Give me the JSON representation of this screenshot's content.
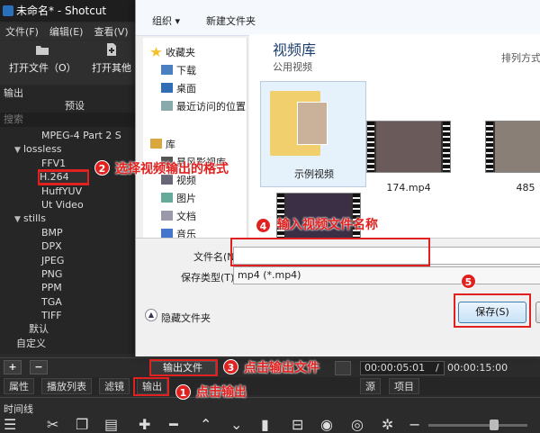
{
  "window": {
    "title": "未命名* - Shotcut"
  },
  "menu": [
    "文件(F)",
    "编辑(E)",
    "查看(V)"
  ],
  "toolbar": {
    "open_file": "打开文件（O）",
    "open_other": "打开其他"
  },
  "export_panel": {
    "header": "输出",
    "column": "预设",
    "search_placeholder": "搜索",
    "items": [
      {
        "label": "MPEG-4 Part 2 S",
        "indent": 3
      },
      {
        "label": "lossless",
        "indent": 1,
        "expanded": true
      },
      {
        "label": "FFV1",
        "indent": 3
      },
      {
        "label": "H.264",
        "indent": 3,
        "selected": true
      },
      {
        "label": "HuffYUV",
        "indent": 3
      },
      {
        "label": "Ut Video",
        "indent": 3
      },
      {
        "label": "stills",
        "indent": 1,
        "expanded": true
      },
      {
        "label": "BMP",
        "indent": 3
      },
      {
        "label": "DPX",
        "indent": 3
      },
      {
        "label": "JPEG",
        "indent": 3
      },
      {
        "label": "PNG",
        "indent": 3
      },
      {
        "label": "PPM",
        "indent": 3
      },
      {
        "label": "TGA",
        "indent": 3
      },
      {
        "label": "TIFF",
        "indent": 3
      },
      {
        "label": "默认",
        "indent": 2
      },
      {
        "label": "自定义",
        "indent": 1
      }
    ]
  },
  "bottom": {
    "add": "+",
    "remove": "−",
    "export_file": "输出文件",
    "current_time": "00:00:05:01",
    "slash": "/",
    "total_time": "00:00:15:00",
    "tabs": [
      "属性",
      "播放列表",
      "滤镜",
      "输出"
    ],
    "right_tabs": [
      "源",
      "项目"
    ],
    "timeline_label": "时间线"
  },
  "annotations": {
    "n1": "1",
    "t1": "点击输出",
    "n2": "2",
    "t2": "选择视频输出的格式",
    "n3": "3",
    "t3": "点击输出文件",
    "n4": "4",
    "t4": "输入视频文件名称",
    "n5": "5"
  },
  "dialog": {
    "organize": "组织 ▾",
    "new_folder": "新建文件夹",
    "nav": {
      "favorites": "收藏夹",
      "downloads": "下载",
      "desktop": "桌面",
      "recent": "最近访问的位置",
      "libraries": "库",
      "video_lib": "暴风影视库",
      "videos": "视频",
      "pictures": "图片",
      "documents": "文档",
      "music": "音乐"
    },
    "library_title": "视频库",
    "library_subtitle": "公用视频",
    "arrange": "排列方式",
    "files": {
      "folder": "示例视频",
      "f1": "174.mp4",
      "f2": "485"
    },
    "filename_label": "文件名(N):",
    "filename_value": "",
    "filetype_label": "保存类型(T):",
    "filetype_value": "mp4 (*.mp4)",
    "hide_folders": "隐藏文件夹",
    "save": "保存(S)"
  },
  "colors": {
    "annotation_red": "#e1211f",
    "dark_bg": "#2b2b2b"
  }
}
